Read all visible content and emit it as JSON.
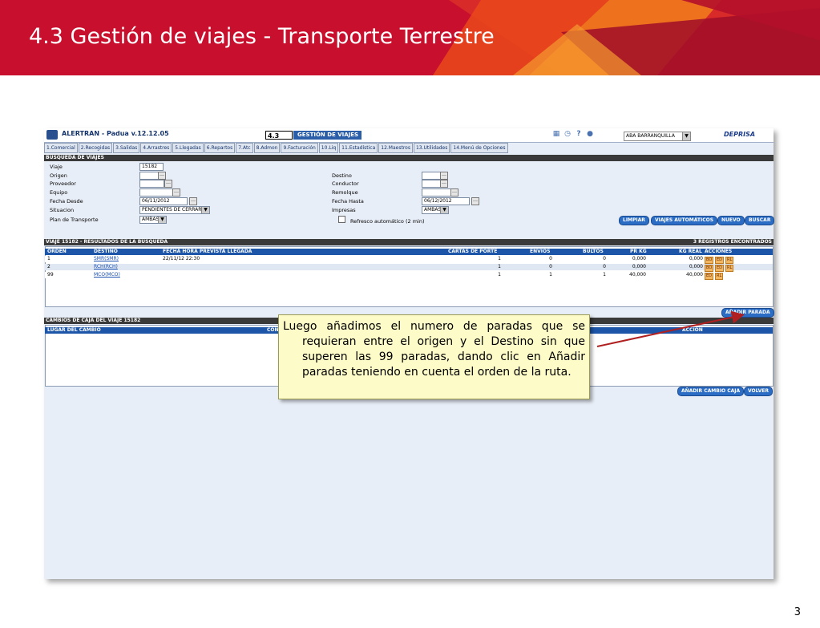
{
  "slide": {
    "title": "4.3 Gestión de viajes - Transporte Terrestre",
    "page_number": "3"
  },
  "app": {
    "name": "ALERTRAN - Padua  v.12.12.05",
    "module_code": "4.3",
    "module_title": "GESTIÓN DE VIAJES",
    "branch": "ABA BARRANQUILLA",
    "brand": "DEPRISA",
    "tabs": [
      "1.Comercial",
      "2.Recogidas",
      "3.Salidas",
      "4.Arrastres",
      "5.Llegadas",
      "6.Repartos",
      "7.Atc",
      "8.Admon",
      "9.Facturación",
      "10.Liq",
      "11.Estadística",
      "12.Maestros",
      "13.Utilidades",
      "14.Menú de Opciones"
    ]
  },
  "search": {
    "section_title": "BÚSQUEDA DE VIAJES",
    "labels": {
      "viaje": "Viaje",
      "origen": "Origen",
      "proveedor": "Proveedor",
      "equipo": "Equipo",
      "fecha_desde": "Fecha Desde",
      "situacion": "Situacion",
      "plan": "Plan de Transporte",
      "destino": "Destino",
      "conductor": "Conductor",
      "remolque": "Remolque",
      "fecha_hasta": "Fecha Hasta",
      "impresas": "Impresas",
      "refresco": "Refresco automático (2 min)"
    },
    "values": {
      "viaje": "15182",
      "fecha_desde": "06/11/2012",
      "fecha_hasta": "06/12/2012",
      "situacion": "PENDIENTES DE CERRAR",
      "plan": "AMBAS",
      "impresas": "AMBAS"
    },
    "buttons": {
      "limpiar": "LIMPIAR",
      "viajes_auto": "VIAJES AUTOMÁTICOS",
      "nuevo": "NUEVO",
      "buscar": "BUSCAR"
    }
  },
  "results": {
    "section_title": "VIAJE 15182 - RESULTADOS DE LA BÚSQUEDA",
    "count": "3 REGISTROS ENCONTRADOS",
    "columns": [
      "ORDEN",
      "DESTINO",
      "FECHA HORA PREVISTA LLEGADA",
      "CARTAS DE PORTE",
      "ENVÍOS",
      "BULTOS",
      "PR KG",
      "KG REAL",
      "ACCIONES"
    ],
    "rows": [
      {
        "orden": "1",
        "destino": "SMR(SMR)",
        "fecha": "22/11/12 22:30",
        "cartas": "1",
        "envios": "0",
        "bultos": "0",
        "pr_kg": "0,000",
        "kg_real": "0,000",
        "acciones": [
          "BO",
          "ED",
          "RL"
        ]
      },
      {
        "orden": "2",
        "destino": "RCH(RCH)",
        "fecha": "",
        "cartas": "1",
        "envios": "0",
        "bultos": "0",
        "pr_kg": "0,000",
        "kg_real": "0,000",
        "acciones": [
          "BO",
          "ED",
          "RL"
        ]
      },
      {
        "orden": "99",
        "destino": "MCO(MCO)",
        "fecha": "",
        "cartas": "1",
        "envios": "1",
        "bultos": "1",
        "pr_kg": "40,000",
        "kg_real": "40,000",
        "acciones": [
          "ED",
          "RL"
        ]
      }
    ],
    "add_stop_button": "AÑADIR PARADA"
  },
  "box_changes": {
    "section_title": "CAMBIOS DE CAJA DEL VIAJE 15182",
    "columns": [
      "LUGAR DEL CAMBIO",
      "CON",
      "ACCIÓN"
    ],
    "add_button": "AÑADIR CAMBIO CAJA",
    "back_button": "VOLVER"
  },
  "callout": {
    "text": "Luego añadimos el numero de paradas que se requieran entre el origen y el Destino sin que superen las 99 paradas, dando clic en Añadir paradas teniendo en cuenta el orden de la ruta."
  },
  "colors": {
    "banner_red": "#c8102e",
    "table_header_blue": "#1d56a8",
    "button_blue": "#2b6cc4",
    "callout_yellow": "#fdfbc8",
    "arrow_red": "#b02020"
  }
}
